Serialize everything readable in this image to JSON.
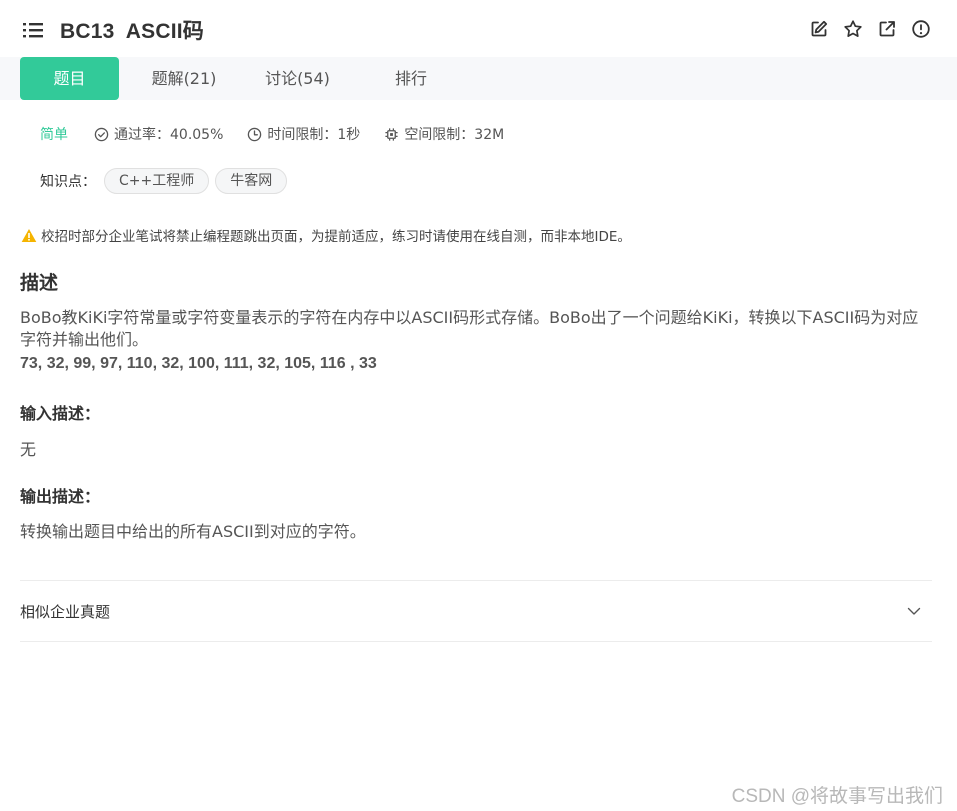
{
  "header": {
    "title": "BC13  ASCII码",
    "actions": [
      "edit-icon",
      "star-icon",
      "external-link-icon",
      "info-icon"
    ]
  },
  "tabs": [
    {
      "label": "题目",
      "active": true
    },
    {
      "label": "题解(21)",
      "active": false
    },
    {
      "label": "讨论(54)",
      "active": false
    },
    {
      "label": "排行",
      "active": false
    }
  ],
  "meta": {
    "difficulty": "简单",
    "pass_rate": "通过率：40.05%",
    "time_limit": "时间限制：1秒",
    "space_limit": "空间限制：32M"
  },
  "knowledge": {
    "label": "知识点：",
    "tags": [
      "C++工程师",
      "牛客网"
    ]
  },
  "warning": "校招时部分企业笔试将禁止编程题跳出页面，为提前适应，练习时请使用在线自测，而非本地IDE。",
  "description": {
    "title": "描述",
    "text": "BoBo教KiKi字符常量或字符变量表示的字符在内存中以ASCII码形式存储。BoBo出了一个问题给KiKi，转换以下ASCII码为对应字符并输出他们。",
    "numbers": "73, 32, 99, 97, 110, 32, 100, 111, 32, 105, 116 , 33"
  },
  "input": {
    "title": "输入描述：",
    "text": "无"
  },
  "output": {
    "title": "输出描述：",
    "text": "转换输出题目中给出的所有ASCII到对应的字符。"
  },
  "similar": {
    "label": "相似企业真题"
  },
  "watermark": "CSDN @将故事写出我们",
  "colors": {
    "accent": "#32ca99",
    "warning": "#f5b400"
  }
}
